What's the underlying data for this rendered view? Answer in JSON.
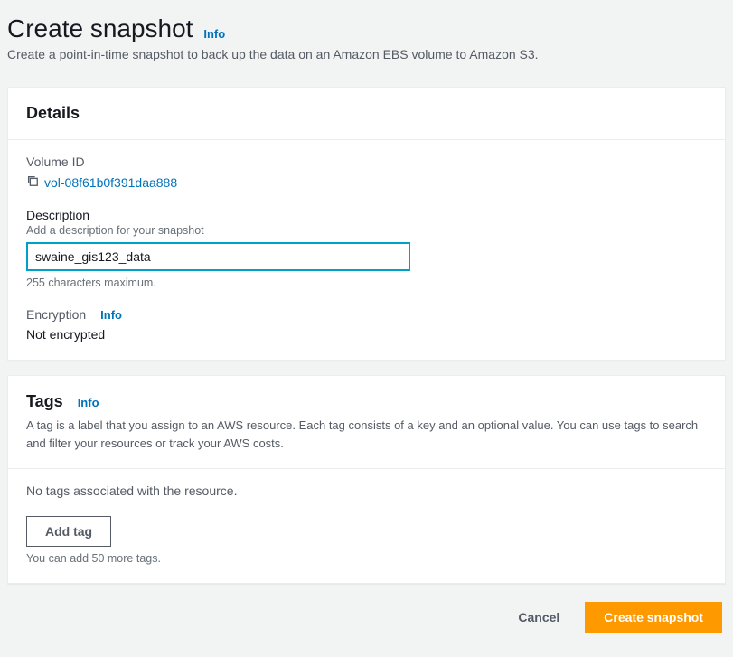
{
  "header": {
    "title": "Create snapshot",
    "info": "Info",
    "subtitle": "Create a point-in-time snapshot to back up the data on an Amazon EBS volume to Amazon S3."
  },
  "details": {
    "panel_title": "Details",
    "volume_id_label": "Volume ID",
    "volume_id_value": "vol-08f61b0f391daa888",
    "description_label": "Description",
    "description_hint": "Add a description for your snapshot",
    "description_value": "swaine_gis123_data",
    "description_help": "255 characters maximum.",
    "encryption_label": "Encryption",
    "encryption_info": "Info",
    "encryption_value": "Not encrypted"
  },
  "tags": {
    "panel_title": "Tags",
    "info": "Info",
    "panel_desc": "A tag is a label that you assign to an AWS resource. Each tag consists of a key and an optional value. You can use tags to search and filter your resources or track your AWS costs.",
    "empty_text": "No tags associated with the resource.",
    "add_tag_label": "Add tag",
    "limit_help": "You can add 50 more tags."
  },
  "footer": {
    "cancel": "Cancel",
    "submit": "Create snapshot"
  }
}
